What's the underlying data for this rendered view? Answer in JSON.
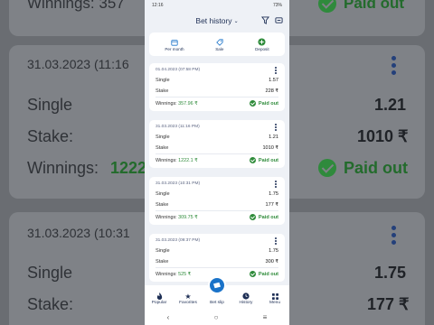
{
  "status_bar": {
    "time": "12:16",
    "battery": "73%"
  },
  "header": {
    "title": "Bet history",
    "chevron": "⌄",
    "icons": [
      "filter-icon",
      "coupon-icon"
    ]
  },
  "actions": [
    {
      "label": "Per month",
      "icon": "calendar-icon"
    },
    {
      "label": "Sale",
      "icon": "tag-icon"
    },
    {
      "label": "Deposit",
      "icon": "plus-circle-icon"
    }
  ],
  "bets": [
    {
      "date": "01.04.2023 (07:58 PM)",
      "type_label": "Single",
      "odds": "1.57",
      "stake_label": "Stake",
      "stake": "228 ₹",
      "winnings_label": "Winnings:",
      "winnings": "357.96 ₹",
      "status": "Paid out"
    },
    {
      "date": "31.03.2023 (11:16 PM)",
      "type_label": "Single",
      "odds": "1.21",
      "stake_label": "Stake",
      "stake": "1010 ₹",
      "winnings_label": "Winnings:",
      "winnings": "1222.1 ₹",
      "status": "Paid out"
    },
    {
      "date": "31.03.2023 (10:31 PM)",
      "type_label": "Single",
      "odds": "1.75",
      "stake_label": "Stake",
      "stake": "177 ₹",
      "winnings_label": "Winnings:",
      "winnings": "309.75 ₹",
      "status": "Paid out"
    },
    {
      "date": "31.03.2023 (09:37 PM)",
      "type_label": "Single",
      "odds": "1.75",
      "stake_label": "Stake",
      "stake": "300 ₹",
      "winnings_label": "Winnings:",
      "winnings": "525 ₹",
      "status": "Paid out"
    }
  ],
  "tabs": [
    {
      "label": "Popular",
      "icon": "flame-icon"
    },
    {
      "label": "Favorites",
      "icon": "star-icon"
    },
    {
      "label": "Bet slip",
      "icon": "ticket-icon"
    },
    {
      "label": "History",
      "icon": "clock-icon"
    },
    {
      "label": "Menu",
      "icon": "grid-icon"
    }
  ],
  "nav": {
    "back": "‹",
    "home": "○",
    "recents": "≡"
  },
  "background_zoom": {
    "top_winnings": "Winnings:  357",
    "top_status": "Paid out",
    "date": "31.03.2023 (11:16",
    "single": "Single",
    "odds": "1.21",
    "stake_label": "Stake:",
    "stake": "1010 ₹",
    "winnings_label": "Winnings:",
    "winnings": "1222",
    "status": "Paid out",
    "date2": "31.03.2023 (10:31",
    "single2": "Single",
    "odds2": "1.75",
    "stake_label2": "Stake:",
    "stake2": "177 ₹"
  },
  "colors": {
    "accent": "#1a73c9",
    "paid": "#2e8b3a",
    "navy": "#1e2f55"
  }
}
